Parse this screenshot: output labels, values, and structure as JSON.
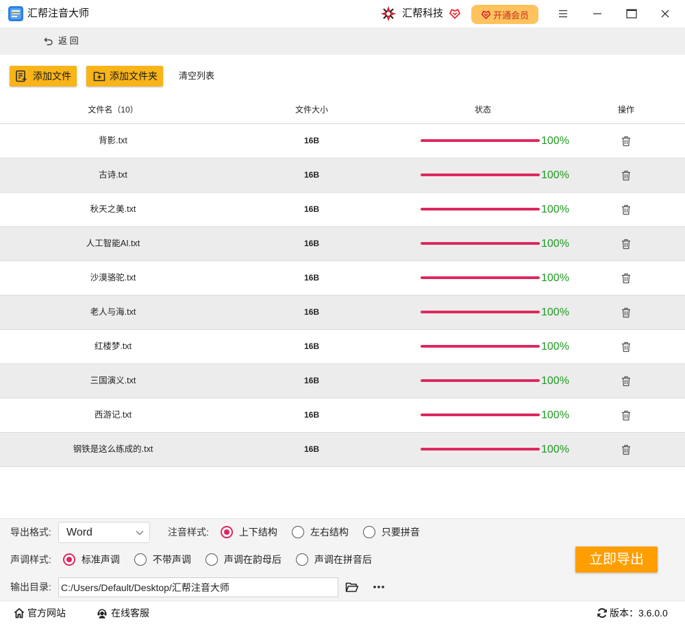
{
  "app": {
    "title": "汇帮注音大师",
    "logo_icon": "app-logo-icon"
  },
  "brand": {
    "name": "汇帮科技",
    "logo_icon": "brand-logo-icon",
    "badge_icon": "vip-heart-icon",
    "vip_button": "开通会员"
  },
  "window_controls": {
    "menu": "menu-icon",
    "minimize": "minimize-icon",
    "maximize": "maximize-icon",
    "close": "close-icon"
  },
  "nav": {
    "back_label": "返 回",
    "back_icon": "back-arrow-icon"
  },
  "toolbar": {
    "add_file": {
      "label": "添加文件",
      "icon": "add-file-icon"
    },
    "add_folder": {
      "label": "添加文件夹",
      "icon": "add-folder-icon"
    },
    "clear_list": "清空列表"
  },
  "table": {
    "headers": {
      "name": "文件名（10）",
      "size": "文件大小",
      "status": "状态",
      "action": "操作"
    },
    "row_action_icon": "trash-icon",
    "rows": [
      {
        "name": "背影.txt",
        "size": "16B",
        "progress": 1,
        "status": "100%"
      },
      {
        "name": "古诗.txt",
        "size": "16B",
        "progress": 1,
        "status": "100%"
      },
      {
        "name": "秋天之美.txt",
        "size": "16B",
        "progress": 1,
        "status": "100%"
      },
      {
        "name": "人工智能AI.txt",
        "size": "16B",
        "progress": 1,
        "status": "100%"
      },
      {
        "name": "沙漠骆驼.txt",
        "size": "16B",
        "progress": 1,
        "status": "100%"
      },
      {
        "name": "老人与海.txt",
        "size": "16B",
        "progress": 1,
        "status": "100%"
      },
      {
        "name": "红楼梦.txt",
        "size": "16B",
        "progress": 1,
        "status": "100%"
      },
      {
        "name": "三国演义.txt",
        "size": "16B",
        "progress": 1,
        "status": "100%"
      },
      {
        "name": "西游记.txt",
        "size": "16B",
        "progress": 1,
        "status": "100%"
      },
      {
        "name": "钢铁是这么练成的.txt",
        "size": "16B",
        "progress": 1,
        "status": "100%"
      }
    ]
  },
  "settings": {
    "export_format": {
      "label": "导出格式:",
      "value": "Word"
    },
    "phonetic_style": {
      "label": "注音样式:",
      "options": [
        "上下结构",
        "左右结构",
        "只要拼音"
      ],
      "selected": 0
    },
    "tone_style": {
      "label": "声调样式:",
      "options": [
        "标准声调",
        "不带声调",
        "声调在韵母后",
        "声调在拼音后"
      ],
      "selected": 0
    },
    "output_dir": {
      "label": "输出目录:",
      "value": "C:/Users/Default/Desktop/汇帮注音大师",
      "browse_icon": "folder-icon",
      "more_icon": "more-icon"
    },
    "export_button": "立即导出"
  },
  "footer": {
    "website": {
      "label": "官方网站",
      "icon": "home-icon"
    },
    "support": {
      "label": "在线客服",
      "icon": "customer-service-icon"
    },
    "version": {
      "label": "版本：3.6.0.0",
      "icon": "refresh-icon"
    }
  },
  "colors": {
    "accent": "#f8b418",
    "vip": "#ffc25d",
    "progress": "#dc2a5e",
    "pct": "#1f9a1f",
    "export": "#ff9e00",
    "radio": "#e0245e"
  }
}
